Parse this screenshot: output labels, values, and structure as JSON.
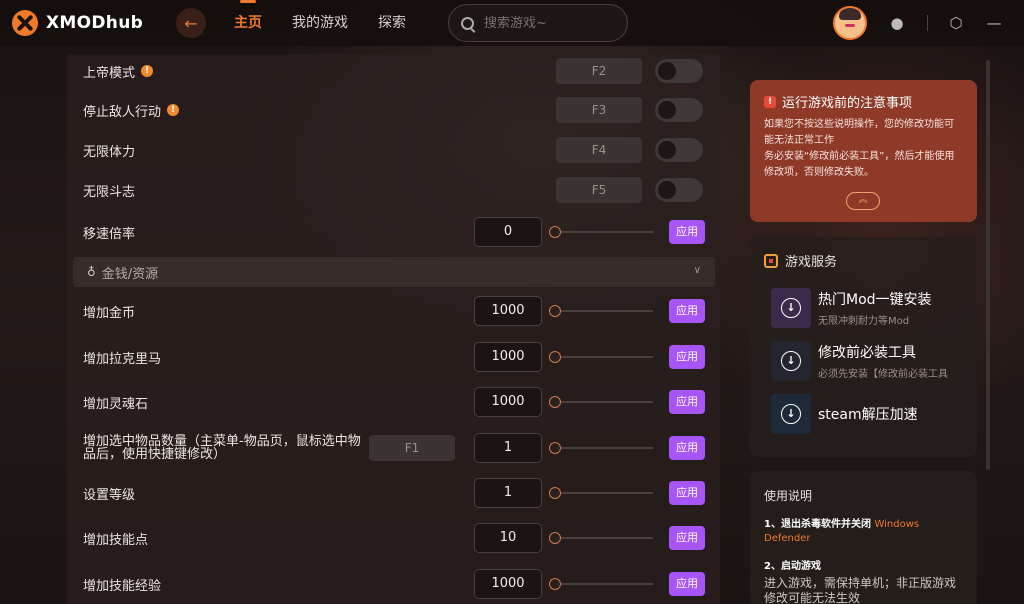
{
  "app": {
    "logo_text": "XMODhub"
  },
  "nav": {
    "back_icon": "back-arrow-icon",
    "items": [
      "主页",
      "我的游戏",
      "探索"
    ],
    "active": 0
  },
  "search": {
    "placeholder": "搜索游戏~"
  },
  "top_icons": [
    "ghost-icon",
    "settings-icon",
    "minimize-icon"
  ],
  "toggles": [
    {
      "label": "上帝模式",
      "info": true,
      "hotkey": "F2",
      "on": false
    },
    {
      "label": "停止敌人行动",
      "info": true,
      "hotkey": "F3",
      "on": false
    },
    {
      "label": "无限体力",
      "info": false,
      "hotkey": "F4",
      "on": false
    },
    {
      "label": "无限斗志",
      "info": false,
      "hotkey": "F5",
      "on": false
    }
  ],
  "speed": {
    "label": "移速倍率",
    "value": "0",
    "apply": "应用"
  },
  "section": {
    "title": "金钱/资源",
    "icon": "money-bag-icon"
  },
  "resources": [
    {
      "label": "增加金币",
      "value": "1000",
      "apply": "应用"
    },
    {
      "label": "增加拉克里马",
      "value": "1000",
      "apply": "应用"
    },
    {
      "label": "增加灵魂石",
      "value": "1000",
      "apply": "应用"
    },
    {
      "label": "增加选中物品数量（主菜单-物品页，鼠标选中物品后，使用快捷键修改）",
      "hotkey": "F1",
      "value": "1",
      "apply": "应用"
    },
    {
      "label": "设置等级",
      "value": "1",
      "apply": "应用"
    },
    {
      "label": "增加技能点",
      "value": "10",
      "apply": "应用"
    },
    {
      "label": "增加技能经验",
      "value": "1000",
      "apply": "应用"
    }
  ],
  "notice": {
    "title": "运行游戏前的注意事项",
    "body1": "如果您不按这些说明操作，您的修改功能可能无法正常工作",
    "body2": "务必安装“修改前必装工具”，然后才能使用修改项，否则修改失败。",
    "collapse_icon": "chevron-up-icon"
  },
  "services": {
    "title": "游戏服务",
    "items": [
      {
        "name": "热门Mod一键安装",
        "sub": "无限冲刺耐力等Mod",
        "color": "#3b2a4a"
      },
      {
        "name": "修改前必装工具",
        "sub": "必须先安装【修改前必装工具】",
        "color": "#252530"
      },
      {
        "name": "steam解压加速",
        "sub": "",
        "color": "#1e2a3a"
      }
    ]
  },
  "instructions": {
    "title": "使用说明",
    "step1": "1、退出杀毒软件并关闭",
    "step1_hl": "Windows Defender",
    "step2": "2、启动游戏",
    "step2_body": "进入游戏，需保持单机；非正版游戏修改可能无法生效"
  }
}
